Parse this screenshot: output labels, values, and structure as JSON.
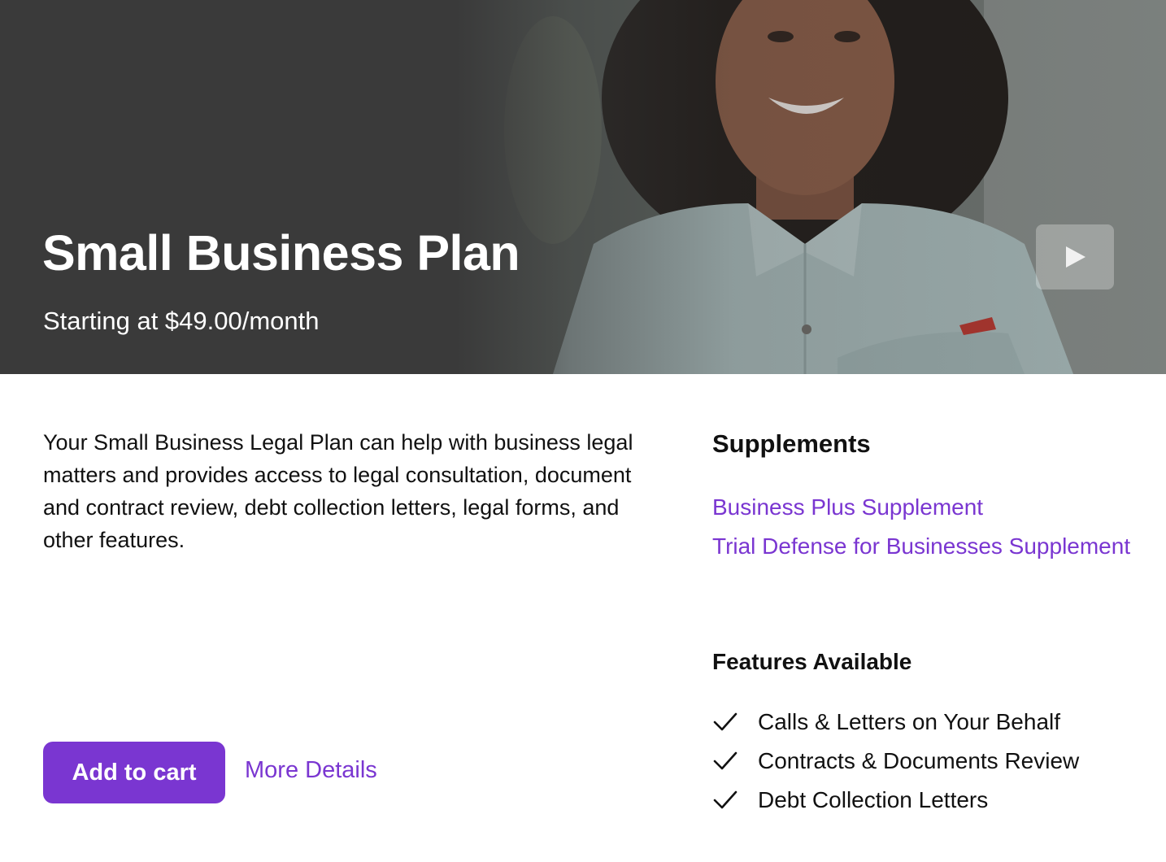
{
  "hero": {
    "title": "Small Business Plan",
    "price": "Starting at $49.00/month",
    "video_button_icon": "play-icon"
  },
  "description": "Your Small Business Legal Plan can help with business legal matters and provides access to legal consultation, document and contract review, debt collection letters, legal forms, and other features.",
  "actions": {
    "add_to_cart_label": "Add to cart",
    "more_details_label": "More Details"
  },
  "supplements": {
    "heading": "Supplements",
    "items": [
      {
        "label": "Business Plus Supplement"
      },
      {
        "label": "Trial Defense for Businesses Supplement"
      }
    ]
  },
  "features": {
    "heading": "Features Available",
    "icon": "checkmark-icon",
    "items": [
      {
        "label": "Calls & Letters on Your Behalf"
      },
      {
        "label": "Contracts & Documents Review"
      },
      {
        "label": "Debt Collection Letters"
      }
    ]
  },
  "colors": {
    "accent": "#7a36d1",
    "hero_background": "#3a3a3a",
    "text": "#111111"
  }
}
